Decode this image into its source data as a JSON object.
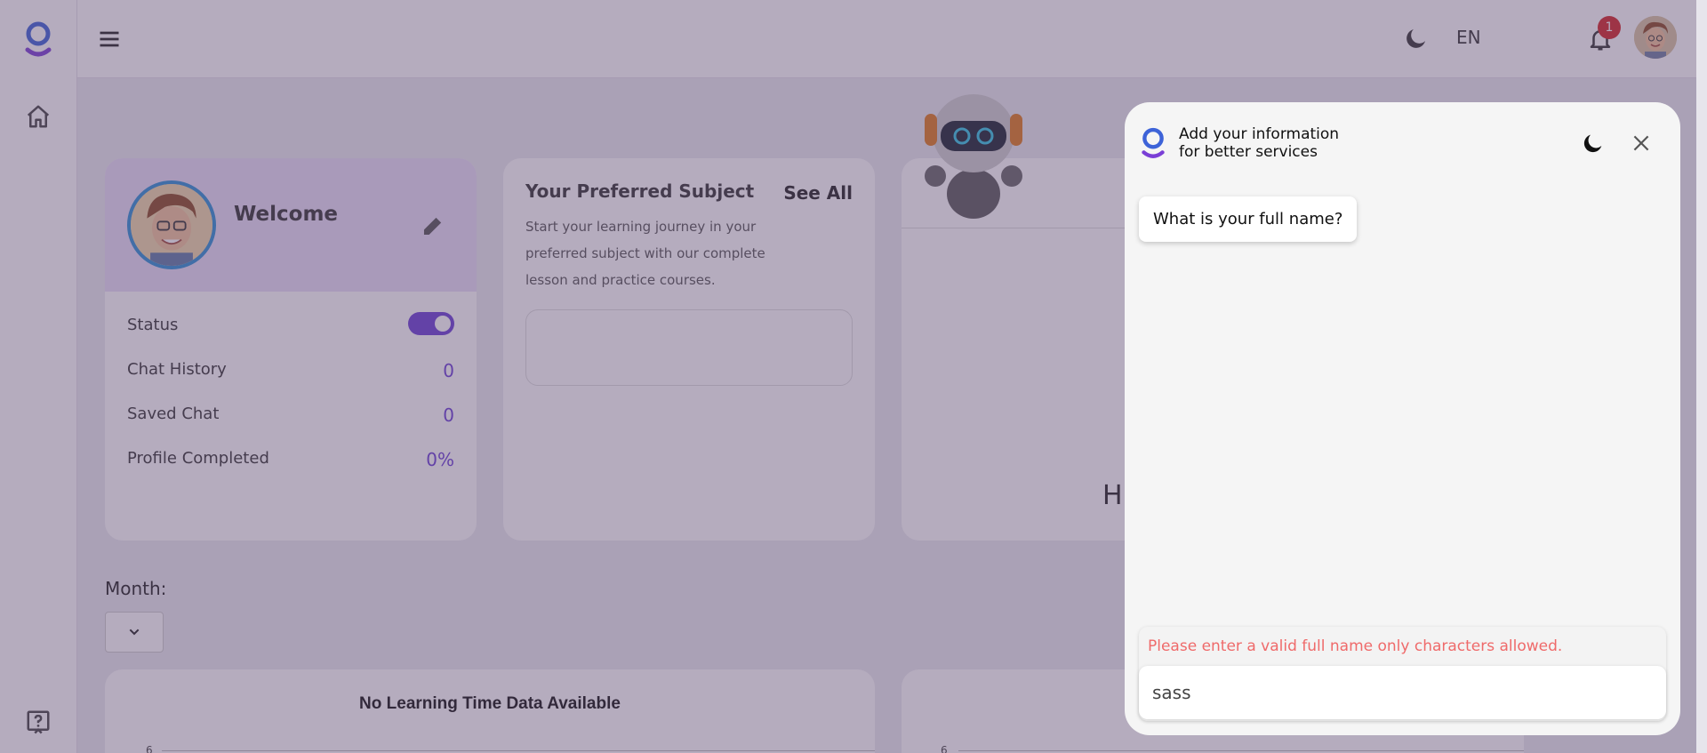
{
  "header": {
    "language": "EN",
    "notification_count": "1"
  },
  "welcome_card": {
    "title": "Welcome",
    "stats": [
      {
        "label": "Status",
        "value": ""
      },
      {
        "label": "Chat History",
        "value": "0"
      },
      {
        "label": "Saved Chat",
        "value": "0"
      },
      {
        "label": "Profile Completed",
        "value": "0%"
      }
    ]
  },
  "subject_card": {
    "title": "Your Preferred Subject",
    "see_all": "See All",
    "description": "Start your learning journey in your preferred subject with our complete lesson and practice courses."
  },
  "third_card": {
    "partial_text": "H"
  },
  "filters": {
    "month_label": "Month:"
  },
  "charts": {
    "left_title": "No Learning Time Data Available",
    "tick_top": "6"
  },
  "dialog": {
    "title_line1": "Add your information",
    "title_line2": "for better services",
    "question": "What is your full name?",
    "error": "Please enter a valid full name only characters allowed.",
    "input_value": "sass"
  },
  "colors": {
    "accent": "#6b3fd6",
    "error": "#ef6a6a",
    "badge": "#d32525"
  }
}
